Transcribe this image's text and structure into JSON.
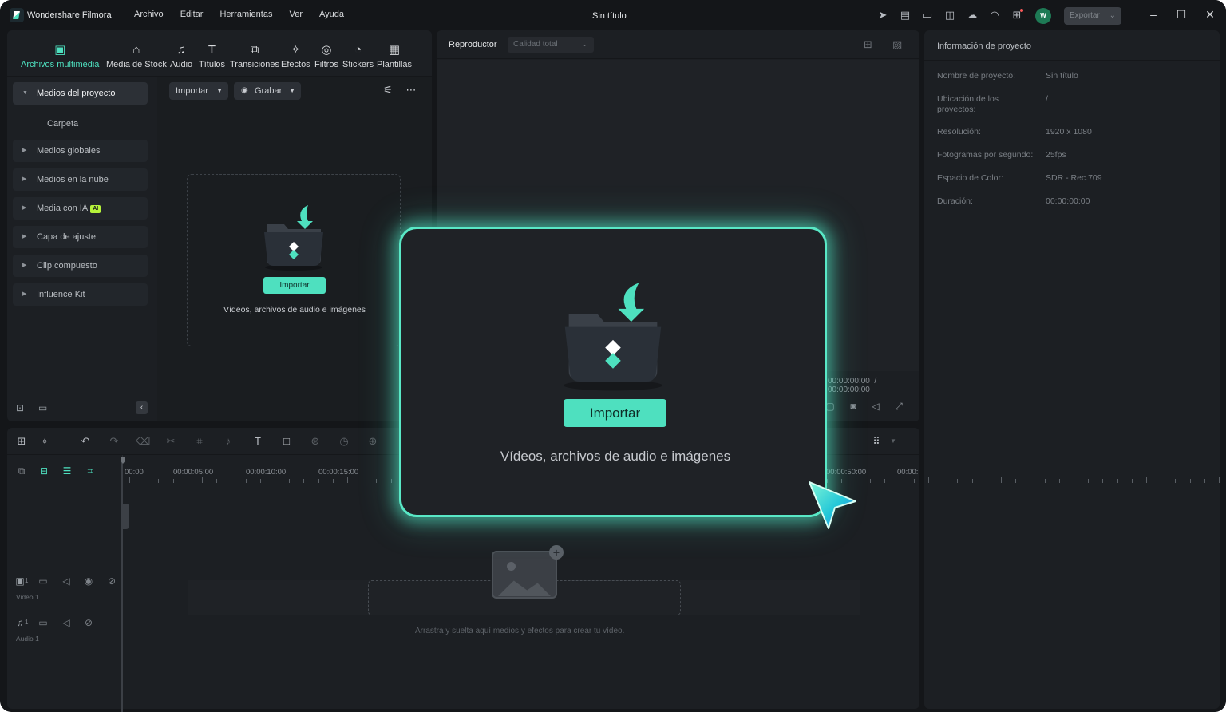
{
  "app": {
    "name": "Wondershare Filmora",
    "doc_title": "Sin título",
    "avatar_initial": "W",
    "export_label": "Exportar",
    "accent": "#4ee0bf"
  },
  "menu": [
    "Archivo",
    "Editar",
    "Herramientas",
    "Ver",
    "Ayuda"
  ],
  "media_tabs": [
    "Archivos multimedia",
    "Media de Stock",
    "Audio",
    "Títulos",
    "Transiciones",
    "Efectos",
    "Filtros",
    "Stickers",
    "Plantillas"
  ],
  "sidebar": {
    "project_media": "Medios del proyecto",
    "folder": "Carpeta",
    "items": [
      "Medios globales",
      "Medios en la nube",
      "Media con IA",
      "Capa de ajuste",
      "Clip compuesto",
      "Influence Kit"
    ],
    "ai_badge": "AI"
  },
  "media_toolbar": {
    "import_label": "Importar",
    "record_label": "Grabar"
  },
  "media_drop": {
    "button": "Importar",
    "caption": "Vídeos, archivos de audio e imágenes"
  },
  "player": {
    "label": "Reproductor",
    "quality": "Calidad total",
    "timecode_current": "00:00:00:00",
    "timecode_total": "00:00:00:00"
  },
  "project_info": {
    "title": "Información de proyecto",
    "rows": [
      {
        "label": "Nombre de proyecto:",
        "value": "Sin título"
      },
      {
        "label": "Ubicación de los proyectos:",
        "value": "/"
      },
      {
        "label": "Resolución:",
        "value": "1920 x 1080"
      },
      {
        "label": "Fotogramas por segundo:",
        "value": "25fps"
      },
      {
        "label": "Espacio de Color:",
        "value": "SDR - Rec.709"
      },
      {
        "label": "Duración:",
        "value": "00:00:00:00"
      }
    ]
  },
  "timeline": {
    "ruler": [
      "00:00",
      "00:00:05:00",
      "00:00:10:00",
      "00:00:15:00",
      "00:00:50:00",
      "00:00:"
    ],
    "tracks": [
      {
        "name": "Video 1",
        "index": "1"
      },
      {
        "name": "Audio 1",
        "index": "1"
      }
    ],
    "drop_caption": "Arrastra y suelta aquí medios y efectos para crear tu vídeo."
  },
  "highlight": {
    "button": "Importar",
    "caption": "Vídeos, archivos de audio e imágenes"
  }
}
